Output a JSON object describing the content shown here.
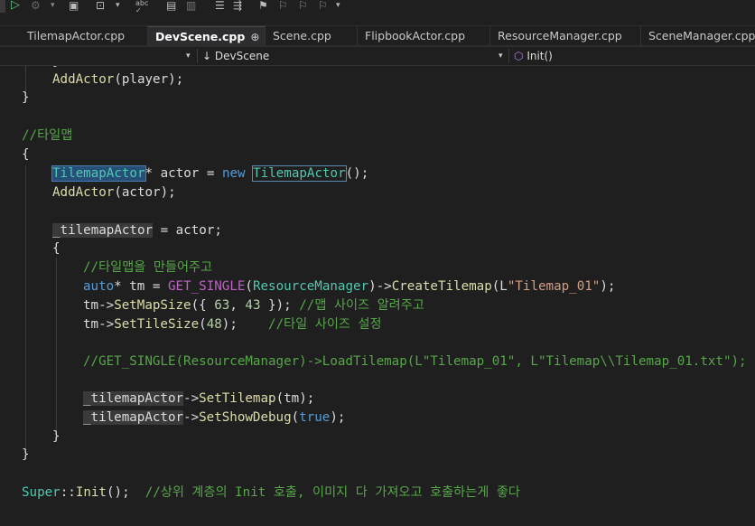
{
  "window": {
    "title": "DevScene.cpp"
  },
  "toolbar": {
    "icons": [
      "play-icon",
      "debug-icon",
      "attach-icon",
      "screenshot-icon",
      "spellcheck-icon",
      "comment-icon",
      "uncomment-icon",
      "bookmark-icon",
      "bookmark-prev-icon",
      "bookmark-next-icon",
      "bookmark-clear-icon",
      "overflow-icon"
    ],
    "spellcheck_label": "abc"
  },
  "tabs": [
    {
      "label": "TilemapActor.cpp",
      "active": false
    },
    {
      "label": "DevScene.cpp",
      "active": true,
      "pin": "⊕",
      "close": "✕"
    },
    {
      "label": "Scene.cpp",
      "active": false
    },
    {
      "label": "FlipbookActor.cpp",
      "active": false
    },
    {
      "label": "ResourceManager.cpp",
      "active": false
    },
    {
      "label": "SceneManager.cpp",
      "active": false
    }
  ],
  "navbar": {
    "scope_class": "DevScene",
    "scope_member": "Init()"
  },
  "code": {
    "l1": "}",
    "l2_fn": "AddActor",
    "l2_arg": "player",
    "l3": "}",
    "c_tilemap": "//타일맵",
    "open1": "{",
    "decl_type1": "TilemapActor",
    "decl_var": "actor",
    "decl_new": "new",
    "decl_type2": "TilemapActor",
    "add_fn": "AddActor",
    "add_arg": "actor",
    "field": "_tilemapActor",
    "assign_rhs": "actor",
    "open2": "{",
    "c_make": "//타일맵을 만들어주고",
    "auto_kw": "auto",
    "auto_var": "tm",
    "get_single": "GET_SINGLE",
    "resmgr": "ResourceManager",
    "create_fn": "CreateTilemap",
    "str_tilemap": "\"Tilemap_01\"",
    "tm": "tm",
    "setmapsize": "SetMapSize",
    "n63": "63",
    "n43": "43",
    "c_mapsize": "//맵 사이즈 알려주고",
    "settilesize": "SetTileSize",
    "n48": "48",
    "c_tilesize": "//타일 사이즈 설정",
    "c_load": "//GET_SINGLE(ResourceManager)->LoadTilemap(L\"Tilemap_01\", L\"Tilemap\\\\Tilemap_01.txt\");",
    "settilemap": "SetTilemap",
    "setshowdebug": "SetShowDebug",
    "true_kw": "true",
    "close2": "}",
    "close1": "}",
    "super_ty": "Super",
    "init_fn": "Init",
    "c_super": "//상위 계층의 Init 호출, 이미지 다 가져오고 호출하는게 좋다"
  },
  "colors": {
    "background": "#1f1f1f",
    "comment": "#57a64a",
    "keyword": "#569cd6",
    "type": "#4ec9b0",
    "function": "#dcdcaa",
    "string": "#d69d85",
    "number": "#b5cea8",
    "macro": "#bd63c5"
  }
}
